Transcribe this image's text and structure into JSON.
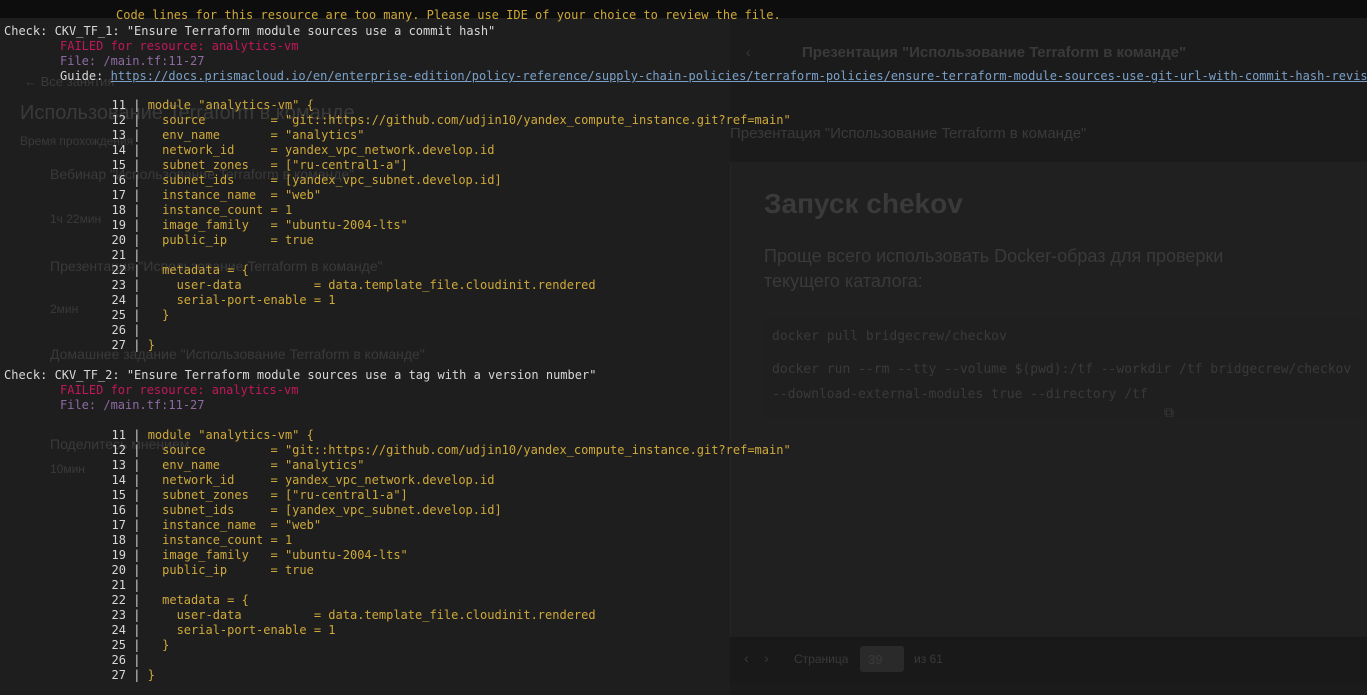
{
  "background_page": {
    "nav_back": "← Все занятия",
    "left_heading": "Использование Terraform в команде",
    "left_sub": "Время прохождения",
    "lessons": [
      {
        "title": "Вебинар \"Использование Terraform в команде\"",
        "meta": "1ч 22мин"
      },
      {
        "title": "Презентация \"Использование Terraform в команде\"",
        "meta": "2мин"
      },
      {
        "title": "Домашнее задание \"Использование Terraform в команде\"",
        "meta": ""
      },
      {
        "title": "Поделитесь мнением",
        "meta": "10мин"
      }
    ],
    "header_title": "Презентация \"Использование Terraform в команде\"",
    "page_title": "Презентация \"Использование Terraform в команде\"",
    "slide": {
      "heading": "Запуск chekov",
      "text_line1": "Проще всего использовать Docker-образ для проверки",
      "text_line2": "текущего каталога:",
      "code1": "docker pull bridgecrew/checkov",
      "code2": "docker run --rm --tty --volume $(pwd):/tf --workdir /tf bridgecrew/checkov",
      "code3": "--download-external-modules true --directory /tf"
    },
    "pager": {
      "label": "Страница",
      "current": "39",
      "of": "из 61"
    }
  },
  "terminal": {
    "notice": "Code lines for this resource are too many. Please use IDE of your choice to review the file.",
    "checks": [
      {
        "title": "Check: CKV_TF_1: \"Ensure Terraform module sources use a commit hash\"",
        "failed": "FAILED for resource: analytics-vm",
        "file": "File: /main.tf:11-27",
        "guide_label": "Guide: ",
        "guide_url": "https://docs.prismacloud.io/en/enterprise-edition/policy-reference/supply-chain-policies/terraform-policies/ensure-terraform-module-sources-use-git-url-with-commit-hash-revision"
      },
      {
        "title": "Check: CKV_TF_2: \"Ensure Terraform module sources use a tag with a version number\"",
        "failed": "FAILED for resource: analytics-vm",
        "file": "File: /main.tf:11-27"
      }
    ],
    "code": [
      {
        "n": "11",
        "bar": " | ",
        "text": "module \"analytics-vm\" {"
      },
      {
        "n": "12",
        "bar": " |   ",
        "text": "source         = \"git::https://github.com/udjin10/yandex_compute_instance.git?ref=main\""
      },
      {
        "n": "13",
        "bar": " |   ",
        "text": "env_name       = \"analytics\""
      },
      {
        "n": "14",
        "bar": " |   ",
        "text": "network_id     = yandex_vpc_network.develop.id"
      },
      {
        "n": "15",
        "bar": " |   ",
        "text": "subnet_zones   = [\"ru-central1-a\"]"
      },
      {
        "n": "16",
        "bar": " |   ",
        "text": "subnet_ids     = [yandex_vpc_subnet.develop.id]"
      },
      {
        "n": "17",
        "bar": " |   ",
        "text": "instance_name  = \"web\""
      },
      {
        "n": "18",
        "bar": " |   ",
        "text": "instance_count = 1"
      },
      {
        "n": "19",
        "bar": " |   ",
        "text": "image_family   = \"ubuntu-2004-lts\""
      },
      {
        "n": "20",
        "bar": " |   ",
        "text": "public_ip      = true"
      },
      {
        "n": "21",
        "bar": " |",
        "text": ""
      },
      {
        "n": "22",
        "bar": " |   ",
        "text": "metadata = {"
      },
      {
        "n": "23",
        "bar": " |     ",
        "text": "user-data          = data.template_file.cloudinit.rendered"
      },
      {
        "n": "24",
        "bar": " |     ",
        "text": "serial-port-enable = 1"
      },
      {
        "n": "25",
        "bar": " |   ",
        "text": "}"
      },
      {
        "n": "26",
        "bar": " |",
        "text": ""
      },
      {
        "n": "27",
        "bar": " | ",
        "text": "}"
      }
    ]
  }
}
